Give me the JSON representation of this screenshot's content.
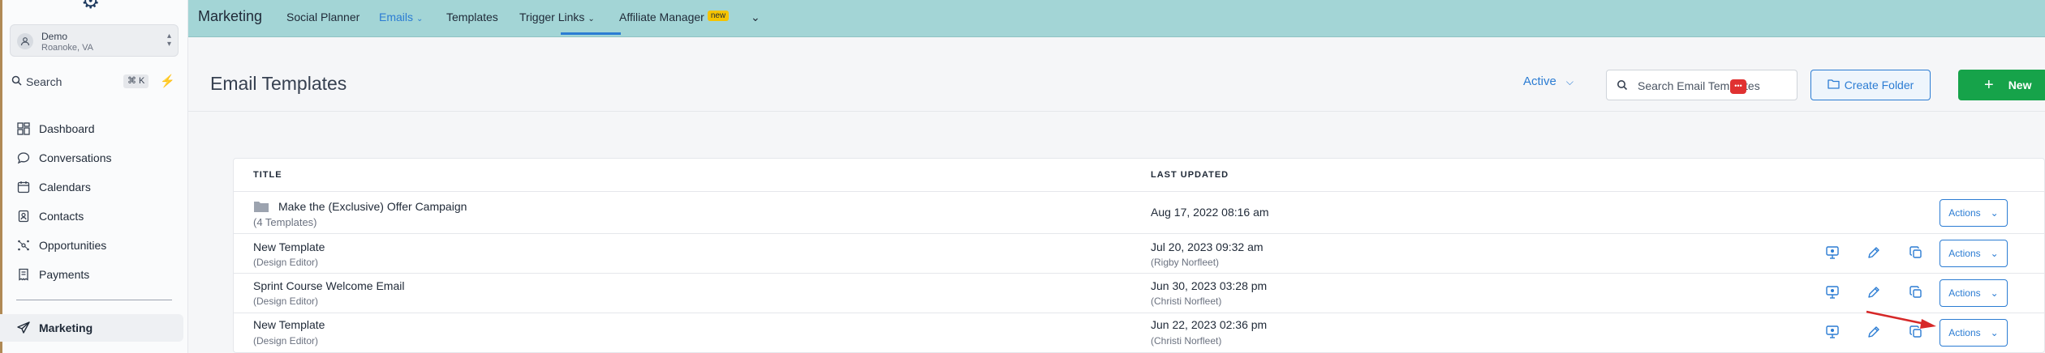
{
  "sidebar": {
    "account": {
      "name": "Demo",
      "location": "Roanoke, VA"
    },
    "search": {
      "label": "Search",
      "shortcut": "⌘ K"
    },
    "nav": [
      {
        "label": "Dashboard",
        "icon": "dashboard-icon"
      },
      {
        "label": "Conversations",
        "icon": "chat-icon"
      },
      {
        "label": "Calendars",
        "icon": "calendar-icon"
      },
      {
        "label": "Contacts",
        "icon": "contacts-icon"
      },
      {
        "label": "Opportunities",
        "icon": "opportunities-icon"
      },
      {
        "label": "Payments",
        "icon": "payments-icon"
      },
      {
        "label": "Marketing",
        "icon": "send-icon",
        "active": true
      }
    ]
  },
  "topbar": {
    "title": "Marketing",
    "tabs": [
      {
        "label": "Social Planner"
      },
      {
        "label": "Emails",
        "active": true
      },
      {
        "label": "Templates"
      },
      {
        "label": "Trigger Links"
      },
      {
        "label": "Affiliate Manager",
        "badge": "new"
      }
    ]
  },
  "page": {
    "title": "Email Templates",
    "status_filter": "Active",
    "search_placeholder": "Search Email Templates",
    "create_folder_label": "Create Folder",
    "new_label": "New"
  },
  "table": {
    "headers": {
      "title": "TITLE",
      "last_updated": "LAST UPDATED"
    },
    "rows": [
      {
        "type": "folder",
        "title": "Make the (Exclusive) Offer Campaign",
        "subtitle": "(4 Templates)",
        "updated": "Aug 17, 2022 08:16 am",
        "by": "",
        "actions_label": "Actions"
      },
      {
        "type": "template",
        "title": "New Template",
        "subtitle": "(Design Editor)",
        "updated": "Jul 20, 2023 09:32 am",
        "by": "(Rigby Norfleet)",
        "actions_label": "Actions"
      },
      {
        "type": "template",
        "title": "Sprint Course Welcome Email",
        "subtitle": "(Design Editor)",
        "updated": "Jun 30, 2023 03:28 pm",
        "by": "(Christi Norfleet)",
        "actions_label": "Actions"
      },
      {
        "type": "template",
        "title": "New Template",
        "subtitle": "(Design Editor)",
        "updated": "Jun 22, 2023 02:36 pm",
        "by": "(Christi Norfleet)",
        "actions_label": "Actions"
      }
    ]
  },
  "colors": {
    "topbar": "#a3d5d6",
    "accent": "#2b7cd3",
    "new_button": "#16a34a",
    "annotation_arrow": "#d62828"
  }
}
